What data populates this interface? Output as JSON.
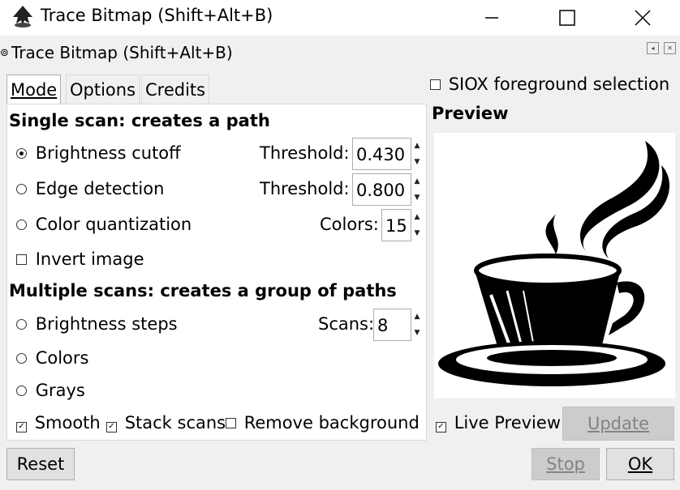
{
  "window": {
    "title": "Trace Bitmap (Shift+Alt+B)",
    "icon": "inkscape-icon"
  },
  "dock": {
    "title": "Trace Bitmap (Shift+Alt+B)"
  },
  "tabs": [
    {
      "label": "Mode",
      "active": true
    },
    {
      "label": "Options",
      "active": false
    },
    {
      "label": "Credits",
      "active": false
    }
  ],
  "single_scan": {
    "heading": "Single scan: creates a path",
    "brightness": {
      "label": "Brightness cutoff",
      "selected": true,
      "param_label": "Threshold:",
      "value": "0.430"
    },
    "edge": {
      "label": "Edge detection",
      "selected": false,
      "param_label": "Threshold:",
      "value": "0.800"
    },
    "color": {
      "label": "Color quantization",
      "selected": false,
      "param_label": "Colors:",
      "value": "15"
    },
    "invert": {
      "label": "Invert image",
      "checked": false
    }
  },
  "multiple_scans": {
    "heading": "Multiple scans: creates a group of paths",
    "brightness_steps": {
      "label": "Brightness steps",
      "selected": false,
      "param_label": "Scans:",
      "value": "8"
    },
    "colors": {
      "label": "Colors",
      "selected": false
    },
    "grays": {
      "label": "Grays",
      "selected": false
    },
    "smooth": {
      "label": "Smooth",
      "checked": true
    },
    "stack": {
      "label": "Stack scans",
      "checked": true
    },
    "remove_bg": {
      "label": "Remove background",
      "checked": false
    }
  },
  "siox": {
    "label": "SIOX foreground selection",
    "checked": false
  },
  "preview": {
    "heading": "Preview",
    "image": "coffee-cup-trace"
  },
  "live_preview": {
    "label": "Live Preview",
    "checked": true
  },
  "buttons": {
    "update": "Update",
    "reset": "Reset",
    "stop": "Stop",
    "ok": "OK"
  }
}
